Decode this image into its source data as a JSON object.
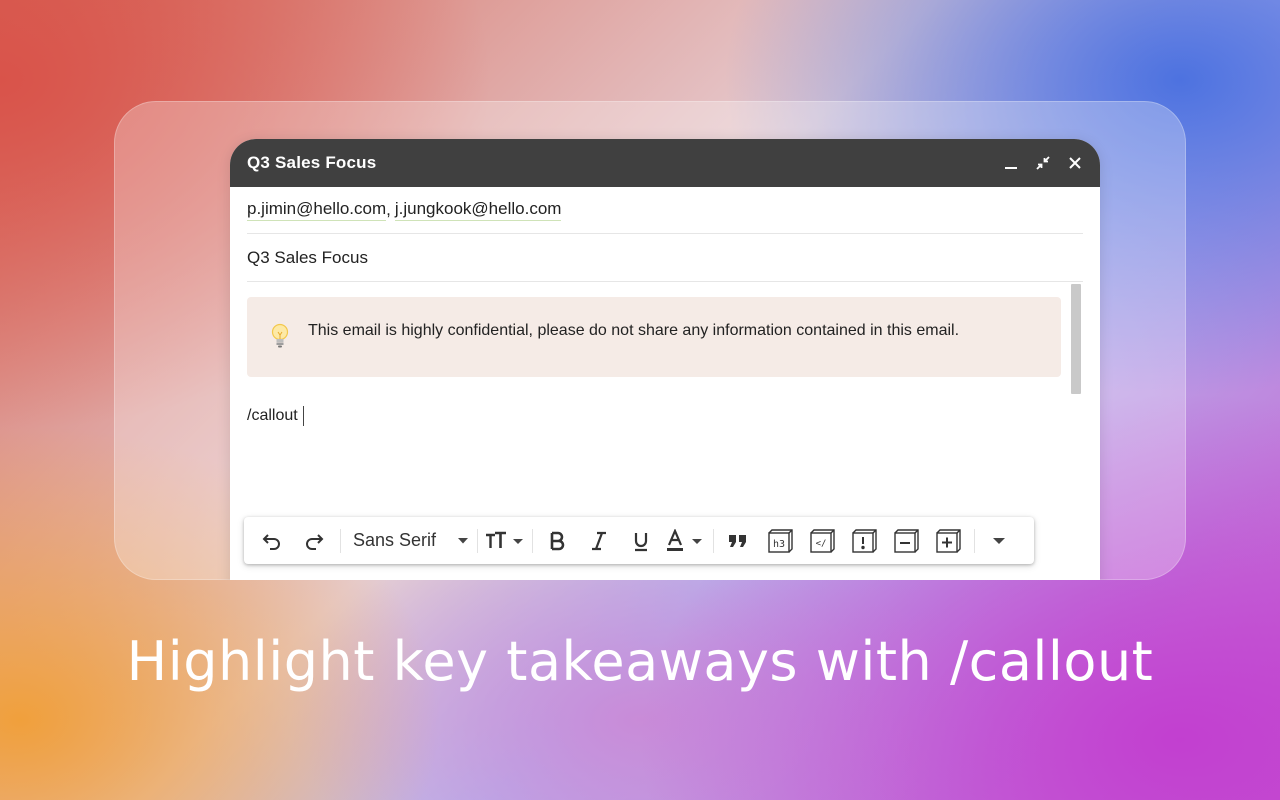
{
  "window": {
    "title": "Q3 Sales Focus"
  },
  "recipients": {
    "items": [
      "p.jimin@hello.com",
      "j.jungkook@hello.com"
    ],
    "separator": ","
  },
  "subject": {
    "value": "Q3 Sales Focus"
  },
  "callout": {
    "icon": "lightbulb-icon",
    "text": "This email is highly confidential, please do not share any information contained in this email."
  },
  "body": {
    "typed_text": "/callout"
  },
  "toolbar": {
    "font_name": "Sans Serif",
    "buttons": [
      "undo",
      "redo",
      "font",
      "font-size",
      "bold",
      "italic",
      "underline",
      "text-color",
      "quote",
      "heading-3",
      "code",
      "alert",
      "collapse",
      "expand",
      "more"
    ]
  },
  "caption": {
    "text": "Highlight key takeaways with /callout"
  },
  "colors": {
    "titlebar": "#404040",
    "callout_bg": "#f5ebe6"
  }
}
